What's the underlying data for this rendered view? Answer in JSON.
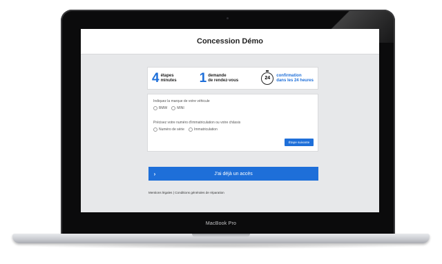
{
  "device": {
    "model_label": "MacBook Pro"
  },
  "site": {
    "title": "Concession Démo"
  },
  "features": [
    {
      "number": "4",
      "line1": "étapes",
      "line2": "minutes"
    },
    {
      "number": "1",
      "line1": "demande",
      "line2": "de rendez-vous"
    },
    {
      "number": "24",
      "line1": "confirmation",
      "line2": "dans les 24 heures"
    }
  ],
  "form": {
    "brand_question": "Indiquez la marque de votre véhicule",
    "brand_options": [
      "BMW",
      "MINI"
    ],
    "plate_question": "Précisez votre numéro d'immatriculation ou votre châssis",
    "id_options": [
      "Numéro de série",
      "Immatriculation"
    ],
    "next_label": "Étape suivante"
  },
  "access": {
    "chevron": "›",
    "label": "J'ai déjà un accès"
  },
  "footer": {
    "links": "Mentions légales | Conditions générales de réparation"
  },
  "colors": {
    "accent": "#1e6fd9",
    "screen_bg": "#e7e8ea",
    "bezel": "#0b0b0c"
  }
}
